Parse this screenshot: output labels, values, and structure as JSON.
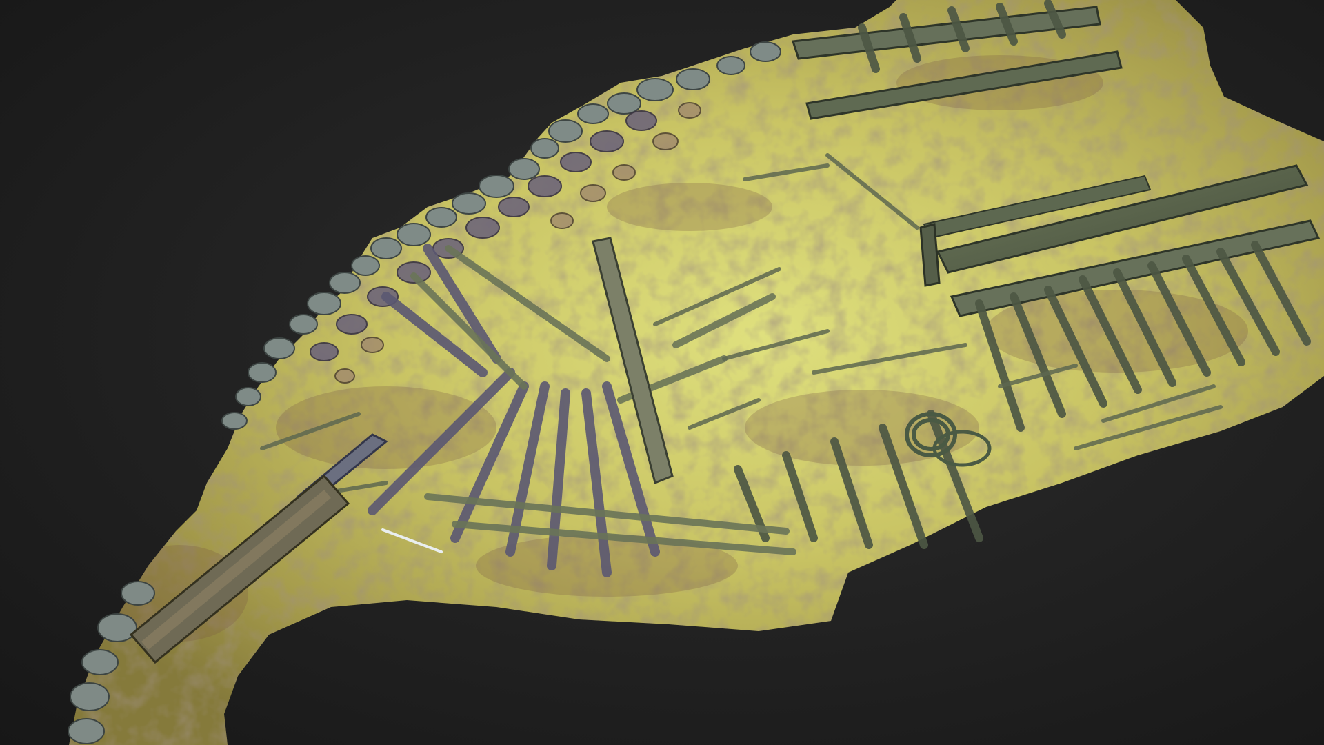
{
  "scene": {
    "subject": "photogrammetry-model-shipwreck",
    "colors": {
      "background": "#222222",
      "sediment_light": "#d8dd7a",
      "sediment_mid": "#b9b35a",
      "sediment_dark": "#8d8440",
      "stain": "#7a5a4a",
      "timber": "#5f6a52",
      "timber_dark": "#3c4436",
      "stone": "#7d8a86",
      "stone_purple": "#6e6679",
      "rope": "#4a5a44"
    }
  }
}
